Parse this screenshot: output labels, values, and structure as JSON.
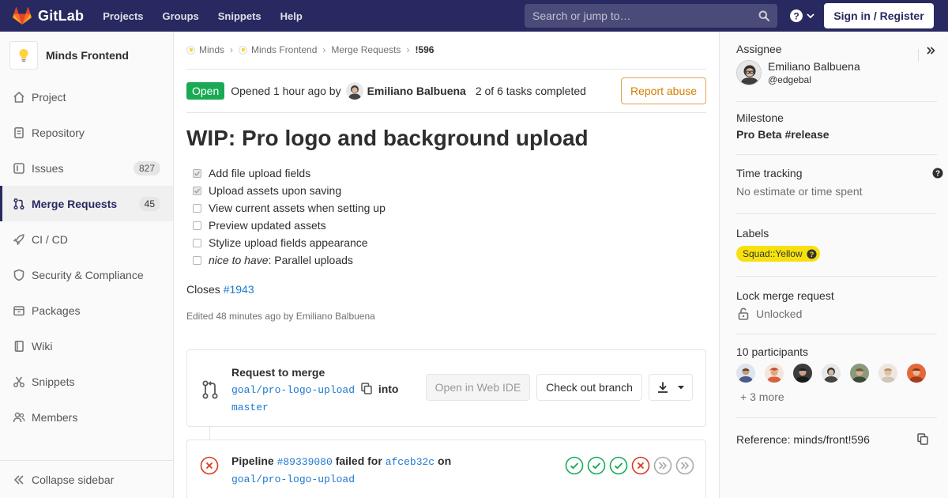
{
  "navbar": {
    "brand": "GitLab",
    "links": [
      "Projects",
      "Groups",
      "Snippets",
      "Help"
    ],
    "search_placeholder": "Search or jump to…",
    "signin": "Sign in / Register"
  },
  "sidebar": {
    "project_name": "Minds Frontend",
    "items": [
      {
        "label": "Project",
        "icon": "home-icon"
      },
      {
        "label": "Repository",
        "icon": "doc-icon"
      },
      {
        "label": "Issues",
        "icon": "issues-icon",
        "count": "827"
      },
      {
        "label": "Merge Requests",
        "icon": "merge-request-icon",
        "count": "45"
      },
      {
        "label": "CI / CD",
        "icon": "rocket-icon"
      },
      {
        "label": "Security & Compliance",
        "icon": "shield-icon"
      },
      {
        "label": "Packages",
        "icon": "package-icon"
      },
      {
        "label": "Wiki",
        "icon": "book-icon"
      },
      {
        "label": "Snippets",
        "icon": "scissors-icon"
      },
      {
        "label": "Members",
        "icon": "users-icon"
      }
    ],
    "collapse": "Collapse sidebar"
  },
  "breadcrumb": [
    "Minds",
    "Minds Frontend",
    "Merge Requests",
    "!596"
  ],
  "mr": {
    "status": "Open",
    "opened": "Opened 1 hour ago by",
    "author": "Emiliano Balbuena",
    "tasks_summary": "2 of 6 tasks completed",
    "report": "Report abuse",
    "title": "WIP: Pro logo and background upload",
    "tasks": [
      {
        "text": "Add file upload fields",
        "checked": true
      },
      {
        "text": "Upload assets upon saving",
        "checked": true
      },
      {
        "text": "View current assets when setting up",
        "checked": false
      },
      {
        "text": "Preview updated assets",
        "checked": false
      },
      {
        "text": "Stylize upload fields appearance",
        "checked": false
      },
      {
        "emph": "nice to have",
        "text": ": Parallel uploads",
        "checked": false
      }
    ],
    "closes_prefix": "Closes",
    "closes_issue": "#1943",
    "edited": "Edited 48 minutes ago by Emiliano Balbuena"
  },
  "widget": {
    "request": "Request to merge",
    "source_branch": "goal/pro-logo-upload",
    "into": "into",
    "target_branch": "master",
    "web_ide": "Open in Web IDE",
    "checkout": "Check out branch"
  },
  "pipeline": {
    "prefix": "Pipeline",
    "id": "#89339080",
    "status": "failed for",
    "commit": "afceb32c",
    "on": "on",
    "branch": "goal/pro-logo-upload",
    "stages": [
      "passed",
      "passed",
      "passed",
      "failed",
      "skipped",
      "skipped"
    ]
  },
  "right": {
    "assignee_title": "Assignee",
    "assignee_name": "Emiliano Balbuena",
    "assignee_handle": "@edgebal",
    "milestone_title": "Milestone",
    "milestone": "Pro Beta #release",
    "time_title": "Time tracking",
    "time_value": "No estimate or time spent",
    "labels_title": "Labels",
    "label": "Squad::Yellow",
    "lock_title": "Lock merge request",
    "lock_value": "Unlocked",
    "participants_title": "10 participants",
    "more": "+ 3 more",
    "reference": "Reference: minds/front!596"
  },
  "colors": {
    "navbar": "#292961",
    "open": "#1aaa55",
    "link": "#1f78d1",
    "label": "#f6e10f",
    "report": "#d57e00"
  }
}
